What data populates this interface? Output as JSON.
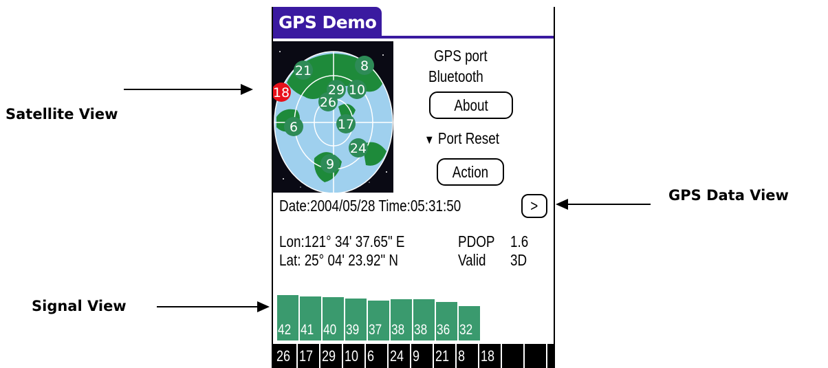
{
  "annotations": {
    "satellite_view": "Satellite View",
    "gps_data_view": "GPS Data View",
    "signal_view": "Signal View"
  },
  "app": {
    "title": "GPS Demo",
    "port_label": "GPS port",
    "port_value": "Bluetooth",
    "about_button": "About",
    "port_reset_icon": "triangle-down-icon",
    "port_reset_label": "Port Reset",
    "action_button": "Action",
    "datetime": "Date:2004/05/28 Time:05:31:50",
    "next_button": ">",
    "lon": "Lon:121° 34' 37.65\" E",
    "lat": "Lat: 25° 04' 23.92\" N",
    "pdop_label": "PDOP",
    "pdop_value": "1.6",
    "valid_label": "Valid",
    "valid_value": "3D"
  },
  "satellites": [
    {
      "id": "21",
      "status": "tracked"
    },
    {
      "id": "8",
      "status": "tracked"
    },
    {
      "id": "18",
      "status": "lost"
    },
    {
      "id": "29",
      "status": "tracked"
    },
    {
      "id": "10",
      "status": "tracked"
    },
    {
      "id": "26",
      "status": "tracked"
    },
    {
      "id": "6",
      "status": "tracked"
    },
    {
      "id": "17",
      "status": "tracked"
    },
    {
      "id": "24",
      "status": "tracked"
    },
    {
      "id": "9",
      "status": "tracked"
    }
  ],
  "signals": [
    {
      "snr": "42",
      "sat": "26"
    },
    {
      "snr": "41",
      "sat": "17"
    },
    {
      "snr": "40",
      "sat": "29"
    },
    {
      "snr": "39",
      "sat": "10"
    },
    {
      "snr": "37",
      "sat": "6"
    },
    {
      "snr": "38",
      "sat": "24"
    },
    {
      "snr": "38",
      "sat": "9"
    },
    {
      "snr": "36",
      "sat": "21"
    },
    {
      "snr": "32",
      "sat": "8"
    },
    {
      "snr": "",
      "sat": "18"
    },
    {
      "snr": "",
      "sat": ""
    },
    {
      "snr": "",
      "sat": ""
    }
  ],
  "colors": {
    "title_bar": "#3a1aa0",
    "satellite_tracked": "#2e8b57",
    "satellite_lost": "#e8101a",
    "signal_bar": "#3a9a6e",
    "ocean": "#9fd0ee",
    "land": "#1e8a3a"
  }
}
